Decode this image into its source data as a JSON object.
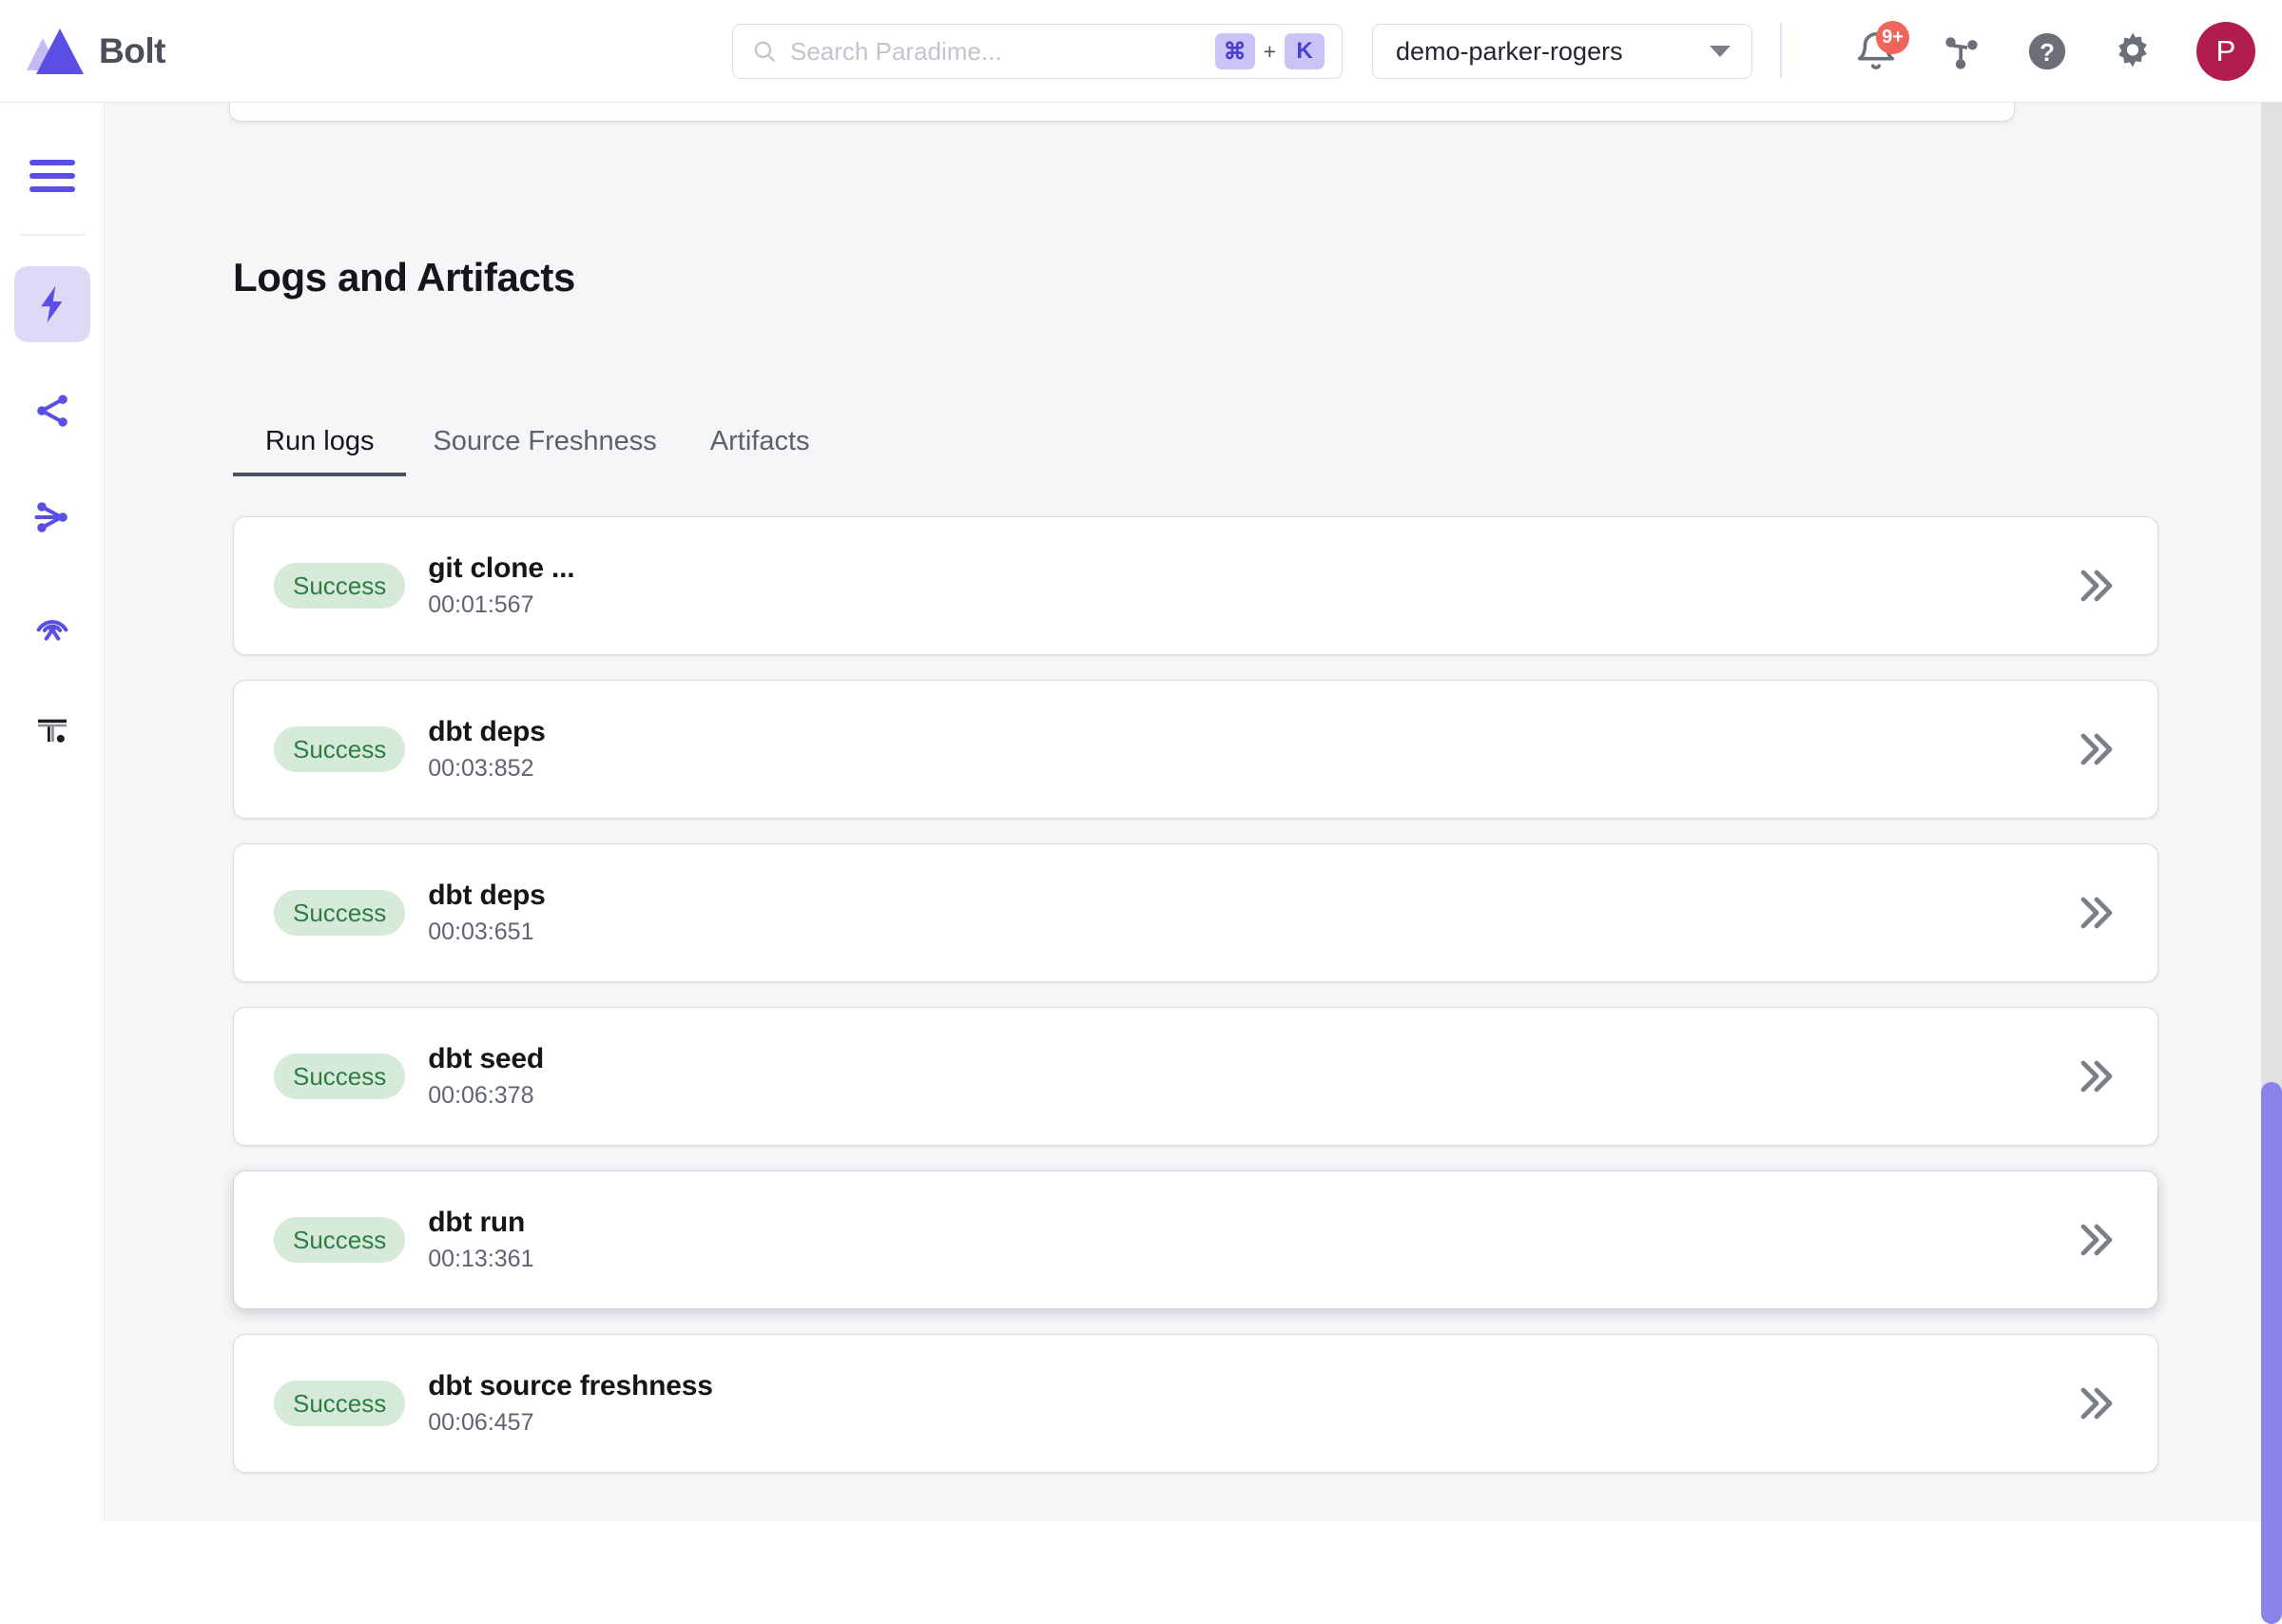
{
  "header": {
    "brand_name": "Bolt",
    "logo_icon": "paradime-triangle-logo",
    "search": {
      "placeholder": "Search Paradime...",
      "value": "",
      "icon": "search-icon",
      "shortcut_modifier": "⌘",
      "shortcut_plus": "+",
      "shortcut_key": "K"
    },
    "workspace": {
      "selected": "demo-parker-rogers",
      "caret_icon": "chevron-down-icon"
    },
    "actions": {
      "notifications": {
        "icon": "bell-icon",
        "badge": "9+",
        "badge_color": "#f0655a"
      },
      "lineage": {
        "icon": "branch-network-icon"
      },
      "help": {
        "icon": "help-circle-icon"
      },
      "settings": {
        "icon": "gear-icon"
      },
      "avatar": {
        "initial": "P",
        "color": "#b31c50"
      }
    }
  },
  "sidebar": {
    "menu_toggle_icon": "hamburger-menu-icon",
    "items": [
      {
        "icon": "lightning-bolt-icon",
        "name": "bolt",
        "active": true
      },
      {
        "icon": "share-nodes-icon",
        "name": "lineage",
        "active": false
      },
      {
        "icon": "branch-split-icon",
        "name": "branches",
        "active": false
      },
      {
        "icon": "radar-signal-icon",
        "name": "radar",
        "active": false
      },
      {
        "icon": "turbo-ci-icon",
        "name": "turbo-ci",
        "active": false
      }
    ]
  },
  "main": {
    "page_title": "Logs and Artifacts",
    "tabs": [
      {
        "label": "Run logs",
        "active": true
      },
      {
        "label": "Source Freshness",
        "active": false
      },
      {
        "label": "Artifacts",
        "active": false
      }
    ],
    "logs": [
      {
        "status": "Success",
        "name": "git clone ...",
        "duration": "00:01:567",
        "hovered": false
      },
      {
        "status": "Success",
        "name": "dbt deps",
        "duration": "00:03:852",
        "hovered": false
      },
      {
        "status": "Success",
        "name": "dbt deps",
        "duration": "00:03:651",
        "hovered": false
      },
      {
        "status": "Success",
        "name": "dbt seed",
        "duration": "00:06:378",
        "hovered": false
      },
      {
        "status": "Success",
        "name": "dbt run",
        "duration": "00:13:361",
        "hovered": true
      },
      {
        "status": "Success",
        "name": "dbt source freshness",
        "duration": "00:06:457",
        "hovered": false
      }
    ],
    "expand_icon": "double-chevron-right-icon"
  },
  "colors": {
    "brand_purple": "#5b4ee5",
    "active_nav_bg": "#ddd9f7",
    "success_bg": "#d5ead9",
    "success_text": "#2f7d45",
    "content_bg": "#f5f6f8",
    "scrollbar_thumb": "#8b82ea"
  }
}
